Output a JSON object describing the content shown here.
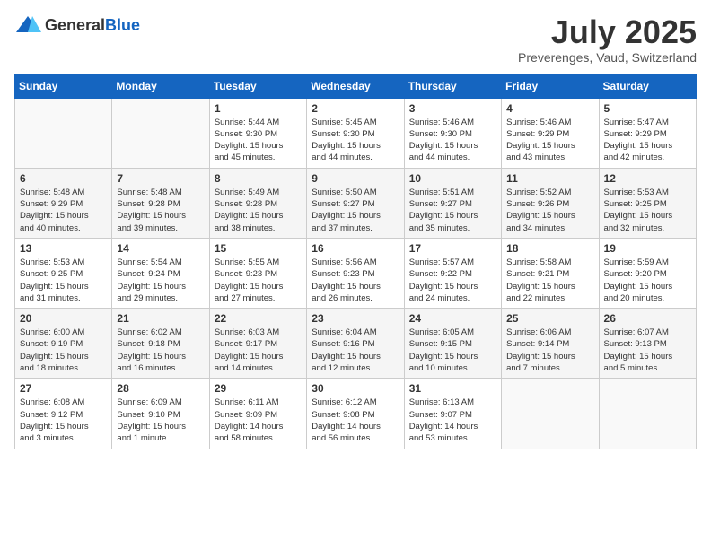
{
  "header": {
    "logo_general": "General",
    "logo_blue": "Blue",
    "month_title": "July 2025",
    "location": "Preverenges, Vaud, Switzerland"
  },
  "days_of_week": [
    "Sunday",
    "Monday",
    "Tuesday",
    "Wednesday",
    "Thursday",
    "Friday",
    "Saturday"
  ],
  "weeks": [
    [
      {
        "day": "",
        "info": ""
      },
      {
        "day": "",
        "info": ""
      },
      {
        "day": "1",
        "info": "Sunrise: 5:44 AM\nSunset: 9:30 PM\nDaylight: 15 hours\nand 45 minutes."
      },
      {
        "day": "2",
        "info": "Sunrise: 5:45 AM\nSunset: 9:30 PM\nDaylight: 15 hours\nand 44 minutes."
      },
      {
        "day": "3",
        "info": "Sunrise: 5:46 AM\nSunset: 9:30 PM\nDaylight: 15 hours\nand 44 minutes."
      },
      {
        "day": "4",
        "info": "Sunrise: 5:46 AM\nSunset: 9:29 PM\nDaylight: 15 hours\nand 43 minutes."
      },
      {
        "day": "5",
        "info": "Sunrise: 5:47 AM\nSunset: 9:29 PM\nDaylight: 15 hours\nand 42 minutes."
      }
    ],
    [
      {
        "day": "6",
        "info": "Sunrise: 5:48 AM\nSunset: 9:29 PM\nDaylight: 15 hours\nand 40 minutes."
      },
      {
        "day": "7",
        "info": "Sunrise: 5:48 AM\nSunset: 9:28 PM\nDaylight: 15 hours\nand 39 minutes."
      },
      {
        "day": "8",
        "info": "Sunrise: 5:49 AM\nSunset: 9:28 PM\nDaylight: 15 hours\nand 38 minutes."
      },
      {
        "day": "9",
        "info": "Sunrise: 5:50 AM\nSunset: 9:27 PM\nDaylight: 15 hours\nand 37 minutes."
      },
      {
        "day": "10",
        "info": "Sunrise: 5:51 AM\nSunset: 9:27 PM\nDaylight: 15 hours\nand 35 minutes."
      },
      {
        "day": "11",
        "info": "Sunrise: 5:52 AM\nSunset: 9:26 PM\nDaylight: 15 hours\nand 34 minutes."
      },
      {
        "day": "12",
        "info": "Sunrise: 5:53 AM\nSunset: 9:25 PM\nDaylight: 15 hours\nand 32 minutes."
      }
    ],
    [
      {
        "day": "13",
        "info": "Sunrise: 5:53 AM\nSunset: 9:25 PM\nDaylight: 15 hours\nand 31 minutes."
      },
      {
        "day": "14",
        "info": "Sunrise: 5:54 AM\nSunset: 9:24 PM\nDaylight: 15 hours\nand 29 minutes."
      },
      {
        "day": "15",
        "info": "Sunrise: 5:55 AM\nSunset: 9:23 PM\nDaylight: 15 hours\nand 27 minutes."
      },
      {
        "day": "16",
        "info": "Sunrise: 5:56 AM\nSunset: 9:23 PM\nDaylight: 15 hours\nand 26 minutes."
      },
      {
        "day": "17",
        "info": "Sunrise: 5:57 AM\nSunset: 9:22 PM\nDaylight: 15 hours\nand 24 minutes."
      },
      {
        "day": "18",
        "info": "Sunrise: 5:58 AM\nSunset: 9:21 PM\nDaylight: 15 hours\nand 22 minutes."
      },
      {
        "day": "19",
        "info": "Sunrise: 5:59 AM\nSunset: 9:20 PM\nDaylight: 15 hours\nand 20 minutes."
      }
    ],
    [
      {
        "day": "20",
        "info": "Sunrise: 6:00 AM\nSunset: 9:19 PM\nDaylight: 15 hours\nand 18 minutes."
      },
      {
        "day": "21",
        "info": "Sunrise: 6:02 AM\nSunset: 9:18 PM\nDaylight: 15 hours\nand 16 minutes."
      },
      {
        "day": "22",
        "info": "Sunrise: 6:03 AM\nSunset: 9:17 PM\nDaylight: 15 hours\nand 14 minutes."
      },
      {
        "day": "23",
        "info": "Sunrise: 6:04 AM\nSunset: 9:16 PM\nDaylight: 15 hours\nand 12 minutes."
      },
      {
        "day": "24",
        "info": "Sunrise: 6:05 AM\nSunset: 9:15 PM\nDaylight: 15 hours\nand 10 minutes."
      },
      {
        "day": "25",
        "info": "Sunrise: 6:06 AM\nSunset: 9:14 PM\nDaylight: 15 hours\nand 7 minutes."
      },
      {
        "day": "26",
        "info": "Sunrise: 6:07 AM\nSunset: 9:13 PM\nDaylight: 15 hours\nand 5 minutes."
      }
    ],
    [
      {
        "day": "27",
        "info": "Sunrise: 6:08 AM\nSunset: 9:12 PM\nDaylight: 15 hours\nand 3 minutes."
      },
      {
        "day": "28",
        "info": "Sunrise: 6:09 AM\nSunset: 9:10 PM\nDaylight: 15 hours\nand 1 minute."
      },
      {
        "day": "29",
        "info": "Sunrise: 6:11 AM\nSunset: 9:09 PM\nDaylight: 14 hours\nand 58 minutes."
      },
      {
        "day": "30",
        "info": "Sunrise: 6:12 AM\nSunset: 9:08 PM\nDaylight: 14 hours\nand 56 minutes."
      },
      {
        "day": "31",
        "info": "Sunrise: 6:13 AM\nSunset: 9:07 PM\nDaylight: 14 hours\nand 53 minutes."
      },
      {
        "day": "",
        "info": ""
      },
      {
        "day": "",
        "info": ""
      }
    ]
  ]
}
